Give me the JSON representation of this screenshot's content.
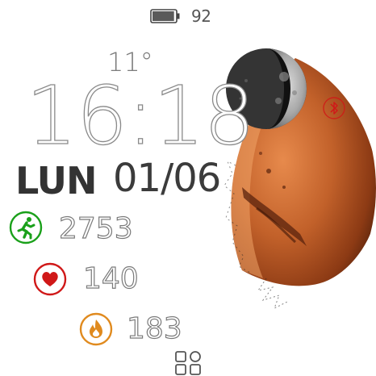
{
  "battery": {
    "value": "92",
    "icon": "battery-icon",
    "level": 0.92
  },
  "weather": {
    "temperature": "11°"
  },
  "clock": {
    "time": "16:18"
  },
  "date": {
    "weekday": "LUN",
    "day_month": "01/06"
  },
  "complications": {
    "steps": {
      "icon": "running-man-icon",
      "value": "2753",
      "color": "#1aa01a"
    },
    "heart_rate": {
      "icon": "heart-icon",
      "value": "140",
      "color": "#d01818"
    },
    "calories": {
      "icon": "flame-icon",
      "value": "183",
      "color": "#e08a1e"
    }
  },
  "status": {
    "bluetooth_icon": "bluetooth-icon",
    "bluetooth_color": "#d01818"
  },
  "art": {
    "planet": "mars-illustration",
    "moon": "moon-illustration",
    "planet_color": "#b5531e"
  },
  "apps_icon": "apps-grid-icon"
}
